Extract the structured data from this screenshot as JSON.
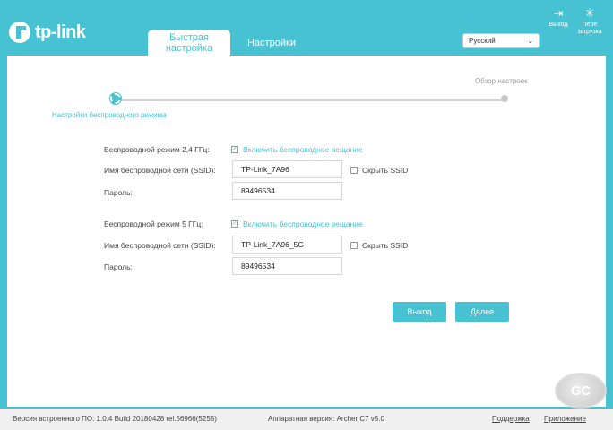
{
  "header": {
    "brand": "tp-link",
    "tabs": [
      {
        "label": "Быстрая настройка"
      },
      {
        "label": "Настройки"
      }
    ],
    "language": "Русский",
    "logout_label": "Выход",
    "reboot_label": "Пере загрузка"
  },
  "wizard": {
    "step_current": "Настройки беспроводного режима",
    "step_next": "Обзор настроек"
  },
  "band24": {
    "label": "Беспроводной режим 2,4 ГГц:",
    "enable_label": "Включить беспроводное вещание",
    "enabled": true,
    "ssid_label": "Имя беспроводной сети (SSID):",
    "ssid_value": "TP-Link_7A96",
    "hide_ssid_label": "Скрыть SSID",
    "hide_ssid": false,
    "password_label": "Пароль:",
    "password_value": "89496534"
  },
  "band5": {
    "label": "Беспроводной режим 5 ГГц:",
    "enable_label": "Включить беспроводное вещание",
    "enabled": true,
    "ssid_label": "Имя беспроводной сети (SSID):",
    "ssid_value": "TP-Link_7A96_5G",
    "hide_ssid_label": "Скрыть SSID",
    "hide_ssid": false,
    "password_label": "Пароль:",
    "password_value": "89496534"
  },
  "buttons": {
    "exit_label": "Выход",
    "next_label": "Далее"
  },
  "footer": {
    "firmware": "Версия встроенного ПО: 1.0.4 Build 20180428 rel.56966(5255)",
    "hardware": "Аппаратная версия: Archer C7 v5.0",
    "support_label": "Поддержка",
    "app_label": "Приложение"
  },
  "watermark": "GC",
  "colors": {
    "accent": "#47c2d2",
    "panel": "#ffffff",
    "footer": "#f0f0f0"
  }
}
